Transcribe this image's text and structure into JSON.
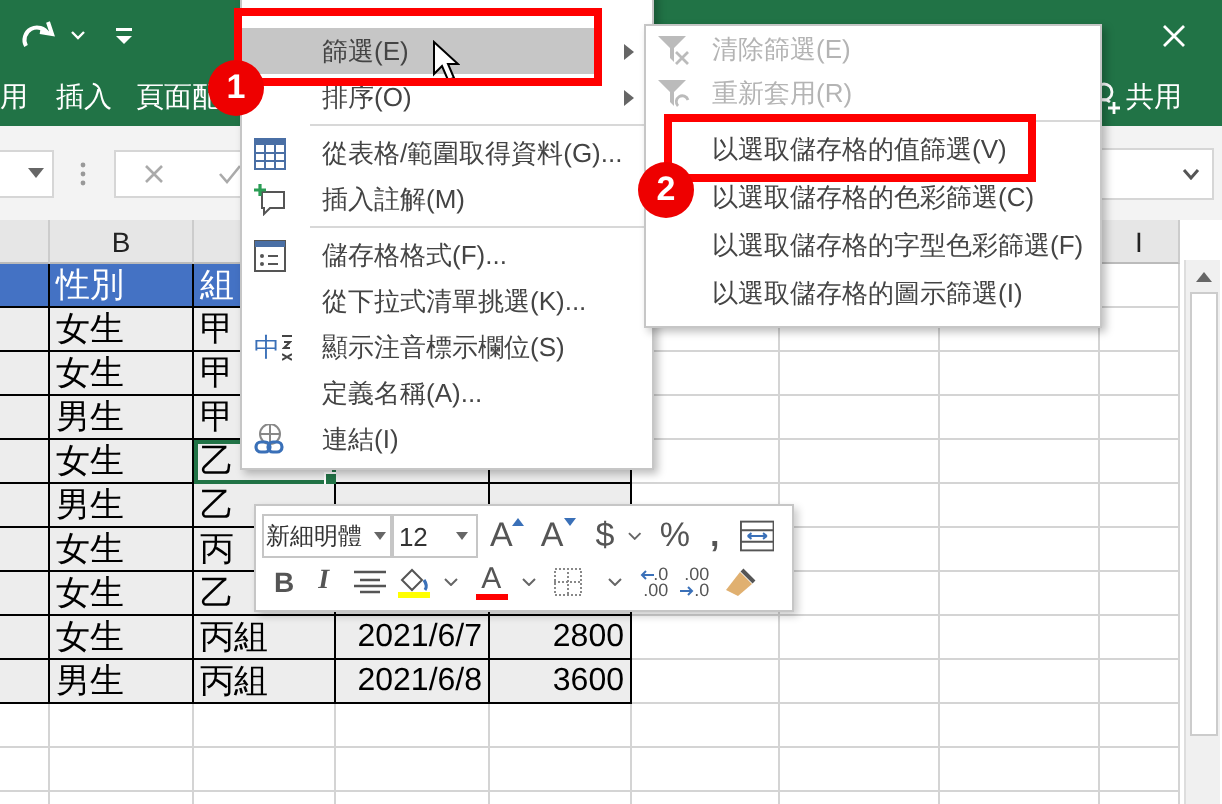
{
  "ribbon": {
    "tabs": [
      {
        "label": "用"
      },
      {
        "label": "插入"
      },
      {
        "label": "頁面配"
      }
    ],
    "share": {
      "label": "共用"
    }
  },
  "column_headers": {
    "column_b": "B",
    "column_i": "I"
  },
  "table": {
    "header": {
      "column_b": "性別",
      "column_c": "組"
    },
    "rows": [
      {
        "column_b": "女生",
        "column_c": "甲",
        "group_cell_active": false
      },
      {
        "column_b": "女生",
        "column_c": "甲",
        "group_cell_active": false
      },
      {
        "column_b": "男生",
        "column_c": "甲",
        "group_cell_active": false
      },
      {
        "column_b": "女生",
        "column_c": "乙",
        "group_cell_active": true
      },
      {
        "column_b": "男生",
        "column_c": "乙",
        "group_cell_active": false
      },
      {
        "column_b": "女生",
        "column_c": "丙",
        "group_cell_active": false
      },
      {
        "column_b": "女生",
        "column_c": "乙",
        "group_cell_active": false
      },
      {
        "column_b": "女生",
        "column_c": "丙組",
        "column_d": "2021/6/7",
        "column_e": "2800",
        "group_cell_active": false
      },
      {
        "column_b": "男生",
        "column_c": "丙組",
        "column_d": "2021/6/8",
        "column_e": "3600",
        "group_cell_active": false
      }
    ]
  },
  "context_menu": {
    "items": [
      {
        "label": "篩選(E)",
        "selected": true,
        "submenu": true,
        "separator_before": false
      },
      {
        "label": "排序(O)",
        "selected": false,
        "submenu": true,
        "separator_before": false
      },
      {
        "label": "從表格/範圍取得資料(G)...",
        "selected": false,
        "submenu": false,
        "separator_before": true,
        "kind": "table"
      },
      {
        "label": "插入註解(M)",
        "selected": false,
        "submenu": false,
        "separator_before": false,
        "kind": "comment"
      },
      {
        "label": "儲存格格式(F)...",
        "selected": false,
        "submenu": false,
        "separator_before": true,
        "kind": "format"
      },
      {
        "label": "從下拉式清單挑選(K)...",
        "selected": false,
        "submenu": false,
        "separator_before": false
      },
      {
        "label": "顯示注音標示欄位(S)",
        "selected": false,
        "submenu": false,
        "separator_before": false,
        "kind": "phonetic",
        "icon_glyph": "中"
      },
      {
        "label": "定義名稱(A)...",
        "selected": false,
        "submenu": false,
        "separator_before": false
      },
      {
        "label": "連結(I)",
        "selected": false,
        "submenu": false,
        "separator_before": false,
        "kind": "link"
      }
    ]
  },
  "submenu": {
    "items": [
      {
        "label": "清除篩選(E)",
        "disabled": true,
        "separator_before": false,
        "kind": "clear_filter"
      },
      {
        "label": "重新套用(R)",
        "disabled": true,
        "separator_before": false,
        "kind": "reapply"
      },
      {
        "label": "以選取儲存格的值篩選(V)",
        "disabled": false,
        "separator_before": true
      },
      {
        "label": "以選取儲存格的色彩篩選(C)",
        "disabled": false,
        "separator_before": false
      },
      {
        "label": "以選取儲存格的字型色彩篩選(F)",
        "disabled": false,
        "separator_before": false
      },
      {
        "label": "以選取儲存格的圖示篩選(I)",
        "disabled": false,
        "separator_before": false
      }
    ]
  },
  "mini_toolbar": {
    "font": "新細明體",
    "font_size": "12",
    "row_1": [
      {
        "kind": "grow",
        "label": "A"
      },
      {
        "kind": "shrink",
        "label": "A"
      },
      {
        "kind": "currency",
        "label": "$"
      },
      {
        "kind": "caret"
      },
      {
        "kind": "percent",
        "label": "%"
      },
      {
        "kind": "comma",
        "label": ","
      },
      {
        "kind": "wrap"
      }
    ],
    "row_2": [
      {
        "kind": "bold",
        "label": "B"
      },
      {
        "kind": "italic",
        "label": "I"
      },
      {
        "kind": "align"
      },
      {
        "kind": "fill",
        "color": "#ffff00"
      },
      {
        "kind": "caret"
      },
      {
        "kind": "font_color",
        "label": "A",
        "color": "#ff0000"
      },
      {
        "kind": "caret"
      },
      {
        "kind": "borders"
      },
      {
        "kind": "caret"
      },
      {
        "kind": "inc_decimal",
        "lines": [
          ".0",
          ".00"
        ]
      },
      {
        "kind": "dec_decimal",
        "lines": [
          ".00",
          ".0"
        ]
      },
      {
        "kind": "painter"
      }
    ]
  },
  "callouts": [
    {
      "number": "1"
    },
    {
      "number": "2"
    }
  ]
}
